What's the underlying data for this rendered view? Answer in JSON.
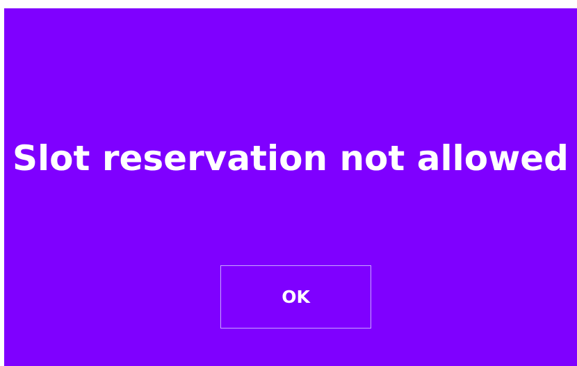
{
  "dialog": {
    "message": "Slot reservation not allowed",
    "ok_label": "OK",
    "colors": {
      "background": "#7f00ff",
      "text": "#ffffff",
      "button_border": "#c9a6ff"
    }
  }
}
